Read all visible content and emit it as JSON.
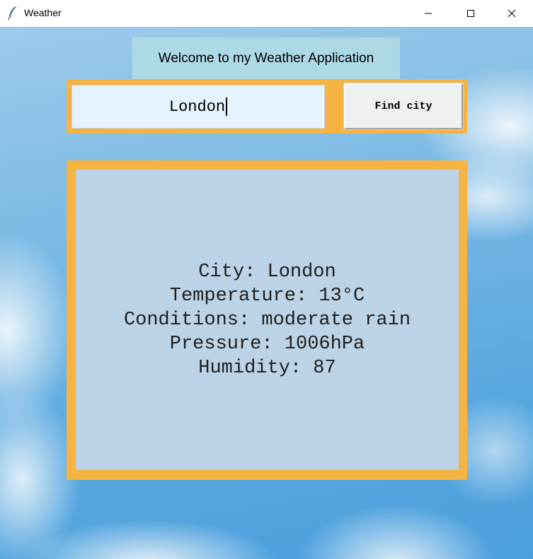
{
  "window": {
    "title": "Weather",
    "icons": {
      "app": "feather-icon",
      "minimize": "minimize-icon",
      "maximize": "maximize-icon",
      "close": "close-icon"
    }
  },
  "header": {
    "welcome": "Welcome to my Weather Application"
  },
  "search": {
    "value": "London",
    "button_label": "Find city"
  },
  "result": {
    "city": "City: London",
    "temperature": "Temperature: 13°C",
    "conditions": "Conditions: moderate rain",
    "pressure": "Pressure: 1006hPa",
    "humidity": "Humidity: 87"
  },
  "colors": {
    "frame": "#f5b342",
    "panel": "#bcd2e6",
    "welcome_bg": "#add8e6",
    "input_bg": "#e6f2ff"
  }
}
